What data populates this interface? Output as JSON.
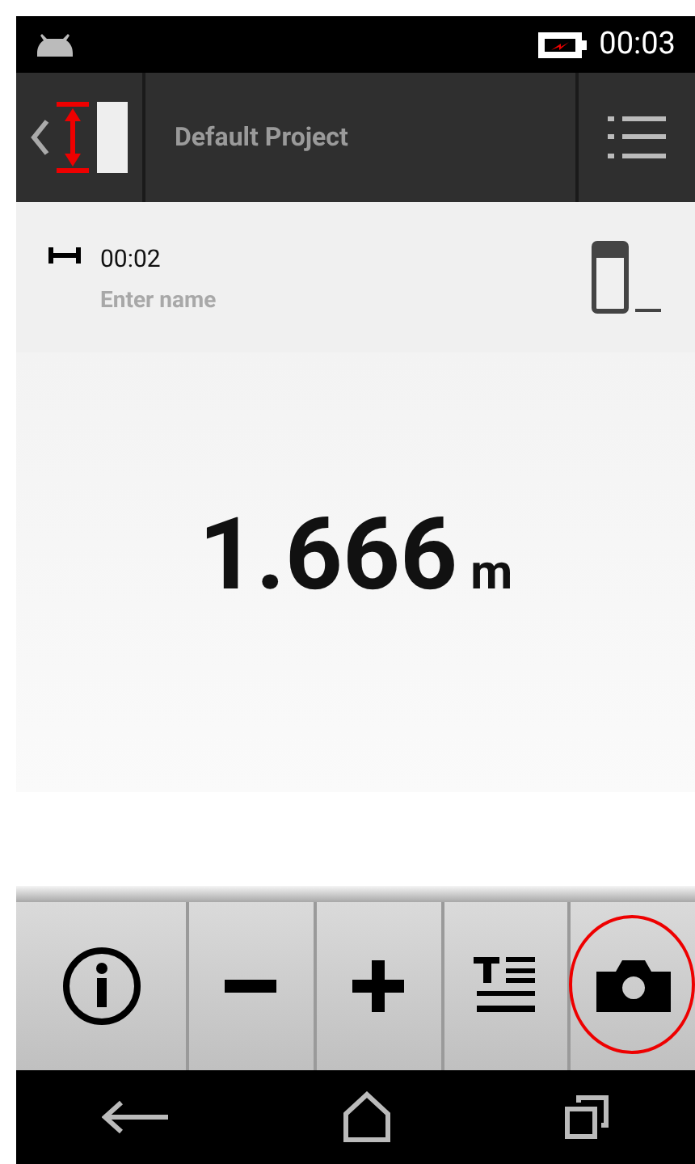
{
  "status_bar": {
    "time": "00:03"
  },
  "header": {
    "title": "Default Project"
  },
  "measurement": {
    "time": "00:02",
    "name_placeholder": "Enter name",
    "value": "1.666",
    "unit": "m"
  },
  "toolbar": {
    "buttons": [
      {
        "kind": "info"
      },
      {
        "kind": "minus"
      },
      {
        "kind": "plus"
      },
      {
        "kind": "text"
      },
      {
        "kind": "camera",
        "highlighted": true
      }
    ]
  }
}
